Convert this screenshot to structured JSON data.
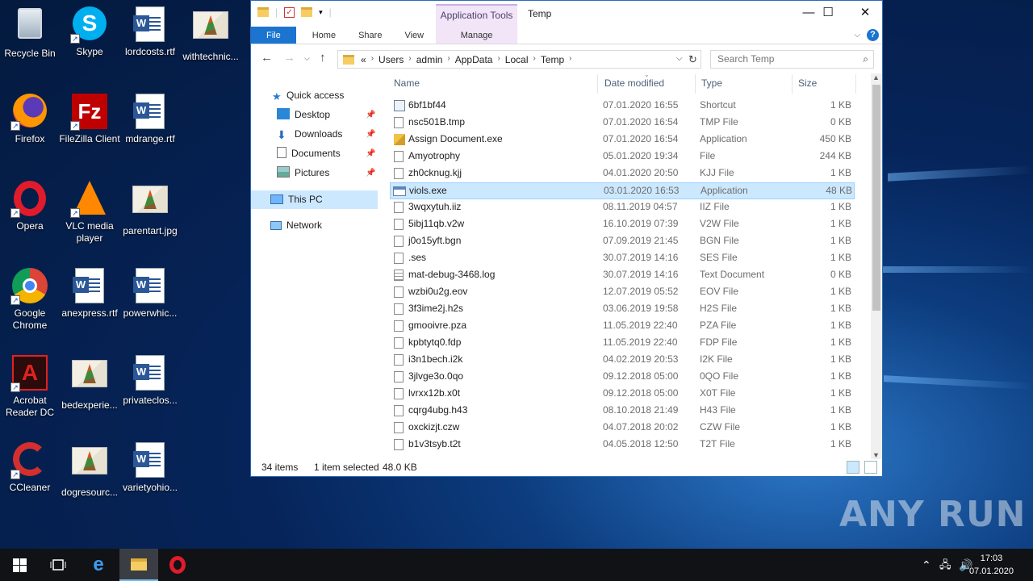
{
  "desktop": {
    "icons": [
      {
        "name": "recycle-bin",
        "label": "Recycle Bin",
        "icon": "recycle-bin-icon"
      },
      {
        "name": "skype",
        "label": "Skype",
        "icon": "skype-icon"
      },
      {
        "name": "lordcosts",
        "label": "lordcosts.rtf",
        "icon": "word-doc-icon"
      },
      {
        "name": "withtechnic",
        "label": "withtechnic...",
        "icon": "image-icon"
      },
      {
        "name": "firefox",
        "label": "Firefox",
        "icon": "firefox-icon"
      },
      {
        "name": "filezilla",
        "label": "FileZilla Client",
        "icon": "filezilla-icon"
      },
      {
        "name": "mdrange",
        "label": "mdrange.rtf",
        "icon": "word-doc-icon"
      },
      {
        "name": "opera",
        "label": "Opera",
        "icon": "opera-icon"
      },
      {
        "name": "vlc",
        "label": "VLC media player",
        "icon": "vlc-icon"
      },
      {
        "name": "parentart",
        "label": "parentart.jpg",
        "icon": "image-icon"
      },
      {
        "name": "chrome",
        "label": "Google Chrome",
        "icon": "chrome-icon"
      },
      {
        "name": "anexpress",
        "label": "anexpress.rtf",
        "icon": "word-doc-icon"
      },
      {
        "name": "powerwhic",
        "label": "powerwhic...",
        "icon": "word-doc-icon"
      },
      {
        "name": "acrobat",
        "label": "Acrobat Reader DC",
        "icon": "acrobat-icon"
      },
      {
        "name": "bedexperie",
        "label": "bedexperie...",
        "icon": "image-icon"
      },
      {
        "name": "privateclos",
        "label": "privateclos...",
        "icon": "word-doc-icon"
      },
      {
        "name": "ccleaner",
        "label": "CCleaner",
        "icon": "ccleaner-icon"
      },
      {
        "name": "dogresourc",
        "label": "dogresourc...",
        "icon": "image-icon"
      },
      {
        "name": "varietyohio",
        "label": "varietyohio...",
        "icon": "word-doc-icon"
      }
    ]
  },
  "window": {
    "title": "Temp",
    "context_tab": "Application Tools",
    "ribbon_tabs": {
      "file": "File",
      "home": "Home",
      "share": "Share",
      "view": "View",
      "manage": "Manage"
    },
    "breadcrumb": [
      "«",
      "Users",
      "admin",
      "AppData",
      "Local",
      "Temp"
    ],
    "search_placeholder": "Search Temp",
    "nav": {
      "quick_access": "Quick access",
      "desktop": "Desktop",
      "downloads": "Downloads",
      "documents": "Documents",
      "pictures": "Pictures",
      "this_pc": "This PC",
      "network": "Network"
    },
    "columns": {
      "name": "Name",
      "date": "Date modified",
      "type": "Type",
      "size": "Size"
    },
    "files": [
      {
        "name": "6bf1bf44",
        "date": "07.01.2020 16:55",
        "type": "Shortcut",
        "size": "1 KB",
        "icon": "shortcut"
      },
      {
        "name": "nsc501B.tmp",
        "date": "07.01.2020 16:54",
        "type": "TMP File",
        "size": "0 KB",
        "icon": "file"
      },
      {
        "name": "Assign Document.exe",
        "date": "07.01.2020 16:54",
        "type": "Application",
        "size": "450 KB",
        "icon": "setup"
      },
      {
        "name": "Amyotrophy",
        "date": "05.01.2020 19:34",
        "type": "File",
        "size": "244 KB",
        "icon": "file"
      },
      {
        "name": "zh0cknug.kjj",
        "date": "04.01.2020 20:50",
        "type": "KJJ File",
        "size": "1 KB",
        "icon": "file"
      },
      {
        "name": "viols.exe",
        "date": "03.01.2020 16:53",
        "type": "Application",
        "size": "48 KB",
        "icon": "exe",
        "selected": true
      },
      {
        "name": "3wqxytuh.iiz",
        "date": "08.11.2019 04:57",
        "type": "IIZ File",
        "size": "1 KB",
        "icon": "file"
      },
      {
        "name": "5ibj11qb.v2w",
        "date": "16.10.2019 07:39",
        "type": "V2W File",
        "size": "1 KB",
        "icon": "file"
      },
      {
        "name": "j0o15yft.bgn",
        "date": "07.09.2019 21:45",
        "type": "BGN File",
        "size": "1 KB",
        "icon": "file"
      },
      {
        "name": ".ses",
        "date": "30.07.2019 14:16",
        "type": "SES File",
        "size": "1 KB",
        "icon": "file"
      },
      {
        "name": "mat-debug-3468.log",
        "date": "30.07.2019 14:16",
        "type": "Text Document",
        "size": "0 KB",
        "icon": "txt"
      },
      {
        "name": "wzbi0u2g.eov",
        "date": "12.07.2019 05:52",
        "type": "EOV File",
        "size": "1 KB",
        "icon": "file"
      },
      {
        "name": "3f3ime2j.h2s",
        "date": "03.06.2019 19:58",
        "type": "H2S File",
        "size": "1 KB",
        "icon": "file"
      },
      {
        "name": "gmooivre.pza",
        "date": "11.05.2019 22:40",
        "type": "PZA File",
        "size": "1 KB",
        "icon": "file"
      },
      {
        "name": "kpbtytq0.fdp",
        "date": "11.05.2019 22:40",
        "type": "FDP File",
        "size": "1 KB",
        "icon": "file"
      },
      {
        "name": "i3n1bech.i2k",
        "date": "04.02.2019 20:53",
        "type": "I2K File",
        "size": "1 KB",
        "icon": "file"
      },
      {
        "name": "3jlvge3o.0qo",
        "date": "09.12.2018 05:00",
        "type": "0QO File",
        "size": "1 KB",
        "icon": "file"
      },
      {
        "name": "lvrxx12b.x0t",
        "date": "09.12.2018 05:00",
        "type": "X0T File",
        "size": "1 KB",
        "icon": "file"
      },
      {
        "name": "cqrg4ubg.h43",
        "date": "08.10.2018 21:49",
        "type": "H43 File",
        "size": "1 KB",
        "icon": "file"
      },
      {
        "name": "oxckizjt.czw",
        "date": "04.07.2018 20:02",
        "type": "CZW File",
        "size": "1 KB",
        "icon": "file"
      },
      {
        "name": "b1v3tsyb.t2t",
        "date": "04.05.2018 12:50",
        "type": "T2T File",
        "size": "1 KB",
        "icon": "file"
      }
    ],
    "status": {
      "items": "34 items",
      "selected": "1 item selected",
      "size": "48.0 KB"
    }
  },
  "taskbar": {
    "time": "17:03",
    "date": "07.01.2020"
  },
  "watermark": "ANY RUN"
}
